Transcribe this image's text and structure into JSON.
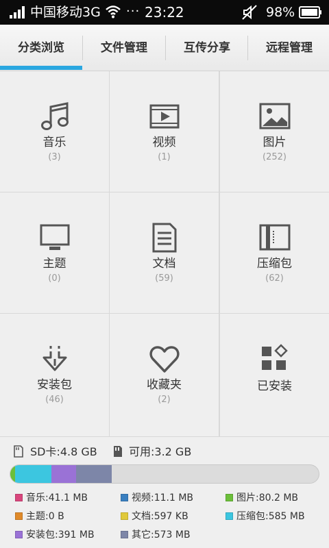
{
  "status_bar": {
    "carrier": "中国移动3G",
    "dots": "···",
    "time": "23:22",
    "battery": "98%"
  },
  "tabs": [
    {
      "label": "分类浏览",
      "active": true
    },
    {
      "label": "文件管理",
      "active": false
    },
    {
      "label": "互传分享",
      "active": false
    },
    {
      "label": "远程管理",
      "active": false
    }
  ],
  "categories": [
    {
      "name": "音乐",
      "count": "(3)",
      "icon": "music-icon"
    },
    {
      "name": "视频",
      "count": "(1)",
      "icon": "video-icon"
    },
    {
      "name": "图片",
      "count": "(252)",
      "icon": "image-icon"
    },
    {
      "name": "主题",
      "count": "(0)",
      "icon": "theme-icon"
    },
    {
      "name": "文档",
      "count": "(59)",
      "icon": "document-icon"
    },
    {
      "name": "压缩包",
      "count": "(62)",
      "icon": "archive-icon"
    },
    {
      "name": "安装包",
      "count": "(46)",
      "icon": "install-package-icon"
    },
    {
      "name": "收藏夹",
      "count": "(2)",
      "icon": "favorites-icon"
    },
    {
      "name": "已安装",
      "count": "",
      "icon": "installed-apps-icon"
    }
  ],
  "storage": {
    "sd_card": "SD卡:4.8 GB",
    "available": "可用:3.2 GB",
    "segments": [
      {
        "color": "#6cbf3a",
        "fraction": 0.016
      },
      {
        "color": "#3cc6e0",
        "fraction": 0.118
      },
      {
        "color": "#9a72d6",
        "fraction": 0.08
      },
      {
        "color": "#7d86a8",
        "fraction": 0.116
      }
    ],
    "legend": [
      {
        "label": "音乐:41.1 MB",
        "color": "#d9467d"
      },
      {
        "label": "视频:11.1 MB",
        "color": "#3a7fc0"
      },
      {
        "label": "图片:80.2 MB",
        "color": "#6cbf3a"
      },
      {
        "label": "主题:0 B",
        "color": "#e08a2a"
      },
      {
        "label": "文档:597 KB",
        "color": "#e0c93a"
      },
      {
        "label": "压缩包:585 MB",
        "color": "#3cc6e0"
      },
      {
        "label": "安装包:391 MB",
        "color": "#9a72d6"
      },
      {
        "label": "其它:573 MB",
        "color": "#7d86a8"
      }
    ]
  }
}
